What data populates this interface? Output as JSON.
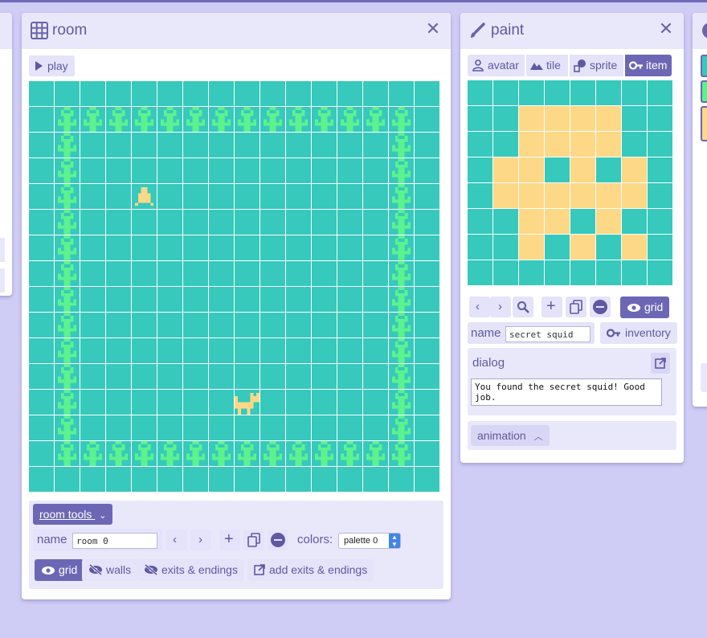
{
  "room_panel": {
    "title": "room",
    "play_label": "play",
    "tools": {
      "toggle_label": "room tools",
      "name_label": "name",
      "name_value": "room 0",
      "colors_label": "colors:",
      "palette_value": "palette 0",
      "grid_label": "grid",
      "walls_label": "walls",
      "exits_label": "exits & endings",
      "add_exits_label": "add exits & endings"
    },
    "map": {
      "size": 16,
      "flower_rows": [
        1,
        14
      ],
      "flower_cols": [
        1,
        14
      ],
      "flower_span": [
        1,
        14
      ],
      "item": {
        "col": 4,
        "row": 4
      },
      "avatar": {
        "col": 8,
        "row": 12
      }
    }
  },
  "paint_panel": {
    "title": "paint",
    "tabs": [
      {
        "label": "avatar",
        "icon": "person-icon",
        "active": false
      },
      {
        "label": "tile",
        "icon": "mountain-icon",
        "active": false
      },
      {
        "label": "sprite",
        "icon": "sprite-icon",
        "active": false
      },
      {
        "label": "item",
        "icon": "key-icon",
        "active": true
      }
    ],
    "grid_label": "grid",
    "name_label": "name",
    "name_value": "secret squid",
    "inventory_label": "inventory",
    "dialog_label": "dialog",
    "dialog_text": "You found the secret squid! Good job.",
    "animation_label": "animation",
    "pixels": [
      [
        0,
        0,
        0,
        0,
        0,
        0,
        0,
        0
      ],
      [
        0,
        0,
        1,
        1,
        1,
        1,
        0,
        0
      ],
      [
        0,
        0,
        1,
        1,
        1,
        1,
        0,
        0
      ],
      [
        0,
        1,
        1,
        0,
        1,
        0,
        1,
        0
      ],
      [
        0,
        1,
        1,
        1,
        1,
        1,
        1,
        0
      ],
      [
        0,
        0,
        1,
        1,
        0,
        1,
        0,
        0
      ],
      [
        0,
        0,
        1,
        0,
        1,
        0,
        1,
        0
      ],
      [
        0,
        0,
        0,
        0,
        0,
        0,
        0,
        0
      ]
    ]
  },
  "colors": {
    "background": "#cfcdf5",
    "room_bg": "#36c9bc",
    "flower": "#5ef28f",
    "sprite_yellow": "#fdd886",
    "accent": "#6c67b5"
  }
}
